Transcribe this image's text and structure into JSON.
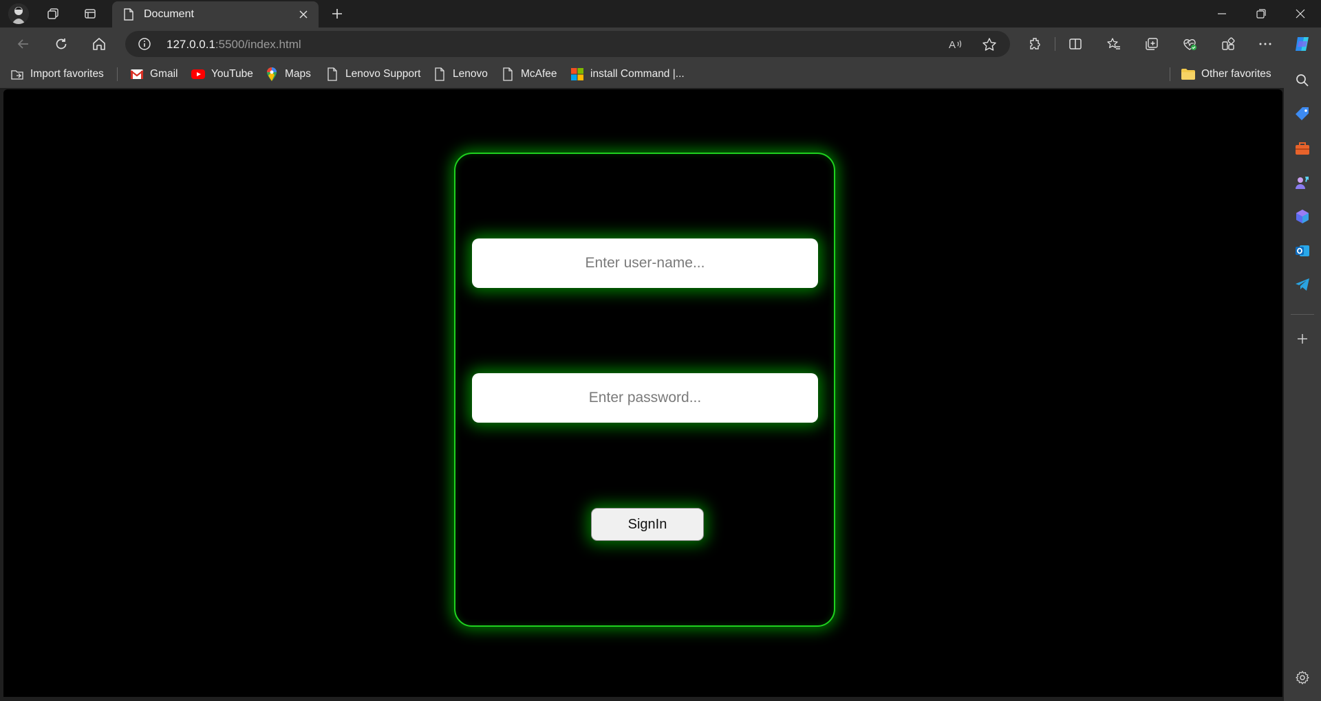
{
  "browser": {
    "tab": {
      "title": "Document",
      "icon": "document-icon"
    },
    "url": {
      "host": "127.0.0.1",
      "rest": ":5500/index.html"
    },
    "toolbar_icons": [
      "back-icon",
      "refresh-icon",
      "home-icon",
      "info-icon",
      "read-aloud-icon",
      "favorite-star-icon",
      "extensions-icon",
      "split-screen-icon",
      "favorites-icon",
      "collections-icon",
      "browser-essentials-icon",
      "workspaces-icon",
      "more-icon",
      "copilot-icon"
    ]
  },
  "favorites": {
    "items": [
      {
        "label": "Import favorites",
        "icon": "import-icon"
      },
      {
        "label": "Gmail",
        "icon": "gmail-icon"
      },
      {
        "label": "YouTube",
        "icon": "youtube-icon"
      },
      {
        "label": "Maps",
        "icon": "maps-icon"
      },
      {
        "label": "Lenovo Support",
        "icon": "page-icon"
      },
      {
        "label": "Lenovo",
        "icon": "page-icon"
      },
      {
        "label": "McAfee",
        "icon": "page-icon"
      },
      {
        "label": "install Command |...",
        "icon": "microsoft-icon"
      }
    ],
    "other": "Other favorites"
  },
  "sidebar_icons": [
    "search-icon",
    "shopping-tag-icon",
    "tools-icon",
    "games-icon",
    "copilot-app-icon",
    "outlook-icon",
    "telegram-icon",
    "add-icon",
    "settings-icon"
  ],
  "login": {
    "username_placeholder": "Enter user-name...",
    "password_placeholder": "Enter password...",
    "signin_label": "SignIn"
  },
  "colors": {
    "glow": "#1fd11f",
    "page_background": "#000000",
    "chrome": "#3b3b3b"
  }
}
